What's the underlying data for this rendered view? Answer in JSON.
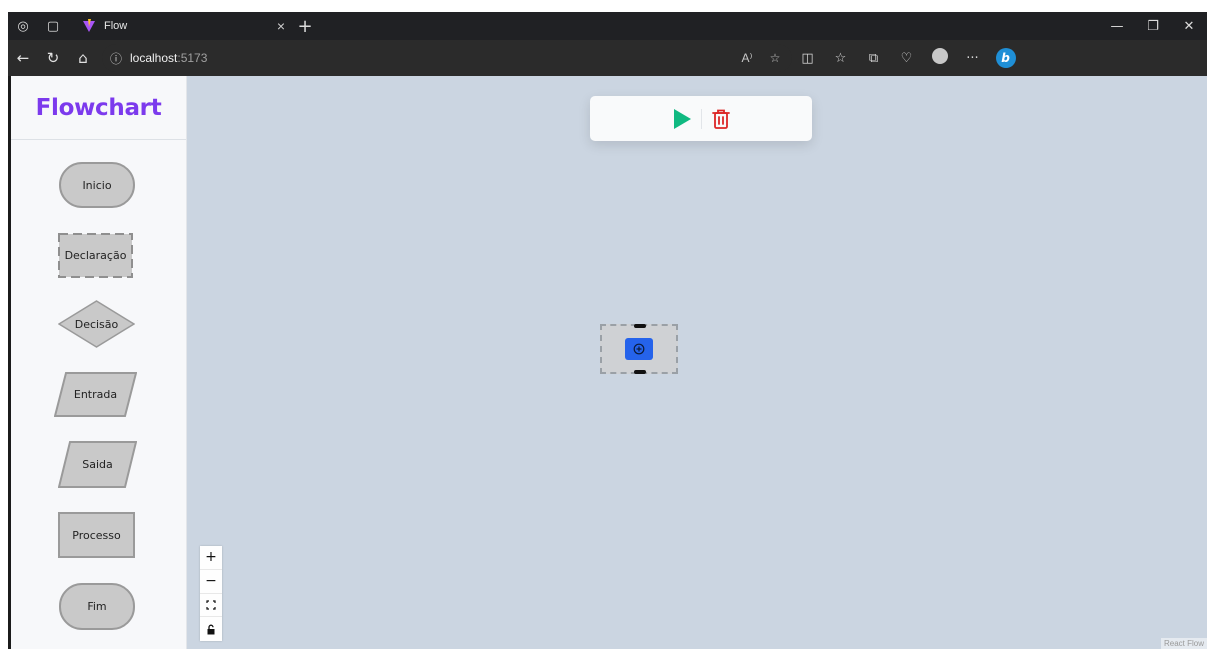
{
  "browser": {
    "tab_title": "Flow",
    "tab_close": "×",
    "new_tab": "+",
    "url_host": "localhost",
    "url_port": ":5173",
    "more_menu": "···"
  },
  "sidebar": {
    "brand": "Flowchart",
    "brand_color": "#7c3aed",
    "shapes": [
      {
        "label": "Inicio",
        "kind": "terminal"
      },
      {
        "label": "Declaração",
        "kind": "declaration"
      },
      {
        "label": "Decisão",
        "kind": "decision"
      },
      {
        "label": "Entrada",
        "kind": "input"
      },
      {
        "label": "Saida",
        "kind": "output"
      },
      {
        "label": "Processo",
        "kind": "process"
      },
      {
        "label": "Fim",
        "kind": "terminal"
      }
    ]
  },
  "canvas": {
    "background": "#cbd5e1",
    "toolbar": {
      "run_icon": "play-icon",
      "run_color": "#10b981",
      "delete_icon": "trash-icon",
      "delete_color": "#dc2626"
    },
    "controls": [
      "+",
      "−",
      "fit",
      "lock"
    ],
    "attribution": "React Flow"
  }
}
